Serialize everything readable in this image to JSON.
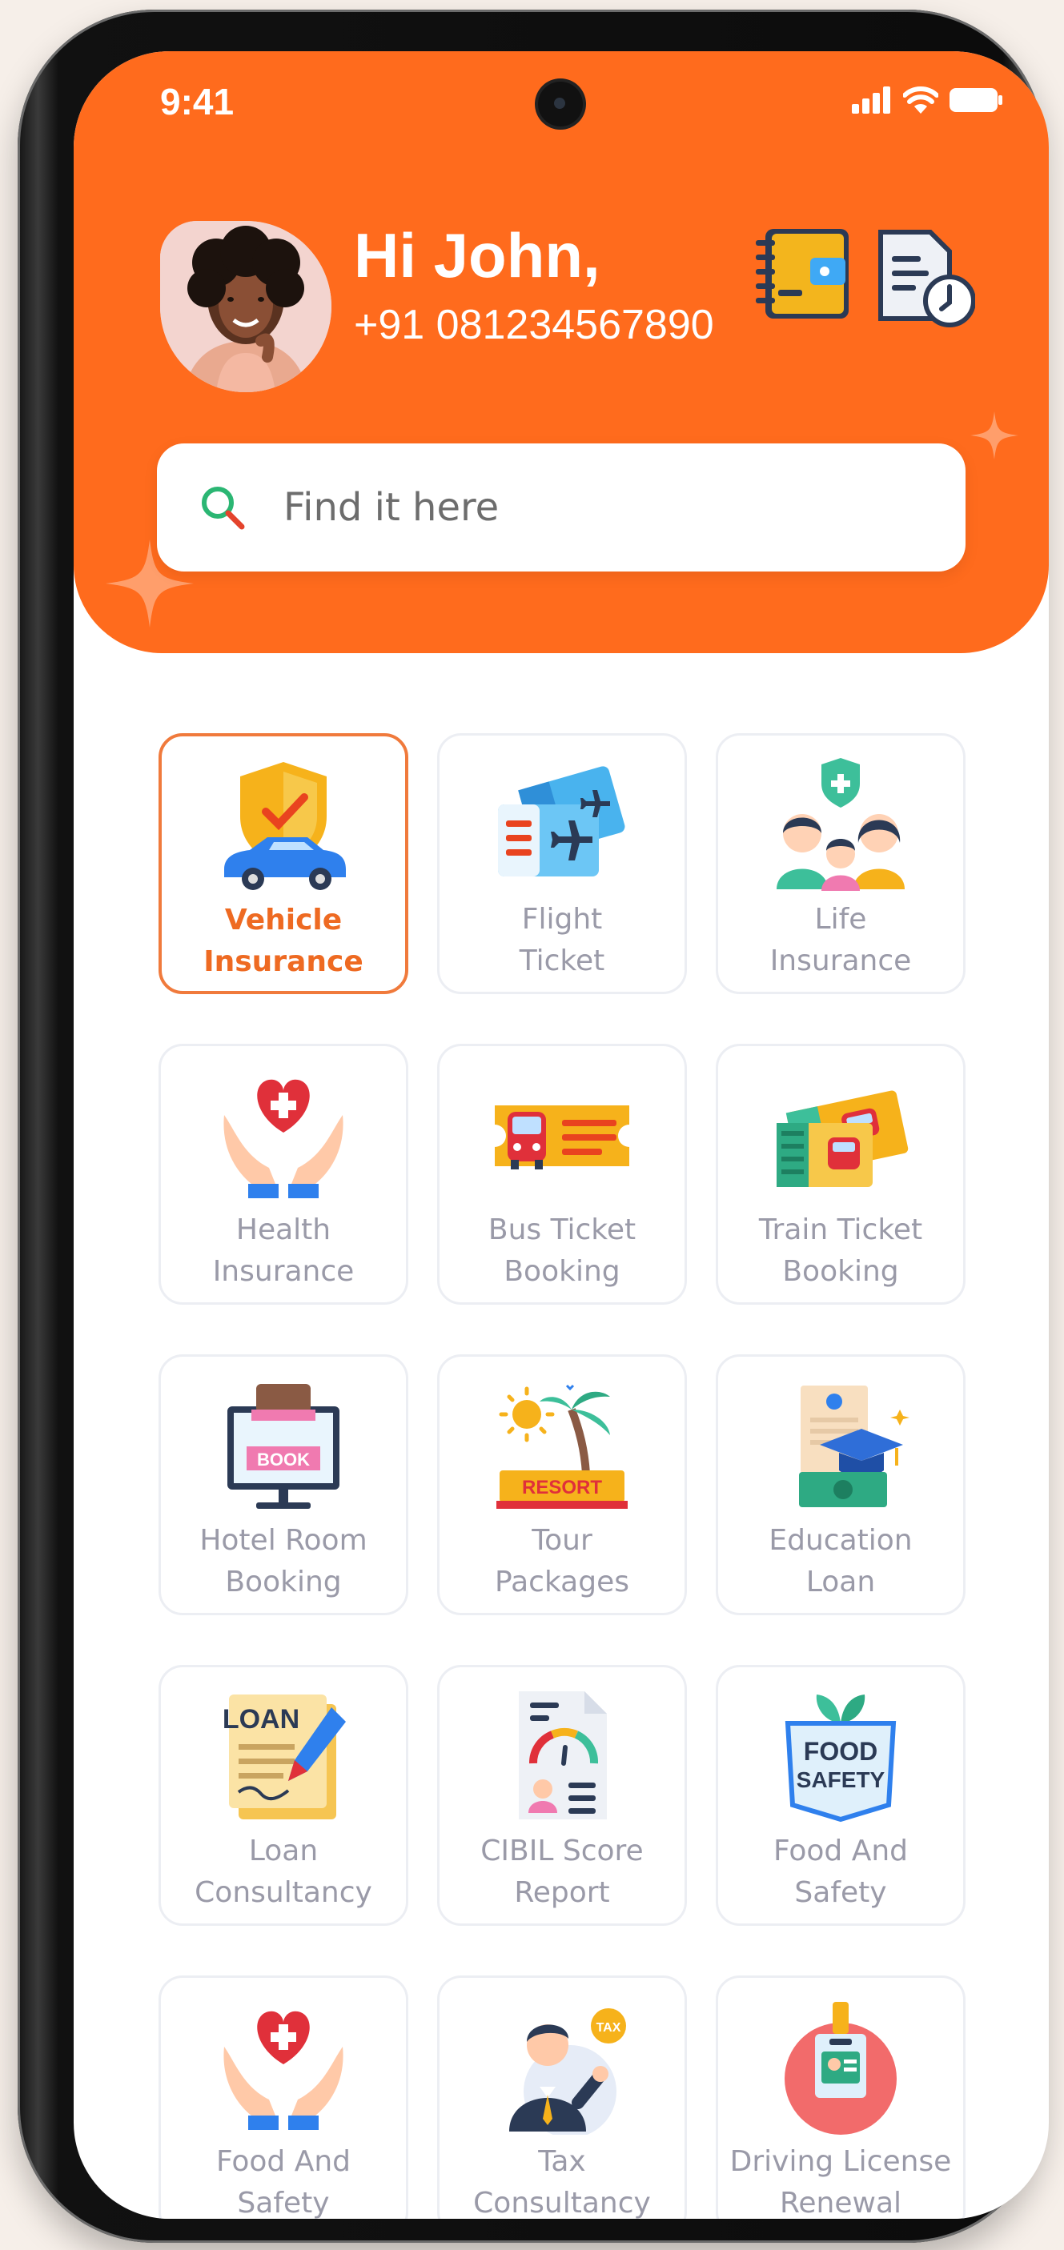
{
  "status_bar": {
    "time": "9:41"
  },
  "header": {
    "greeting": "Hi John,",
    "phone": "+91 081234567890"
  },
  "search": {
    "placeholder": "Find it here"
  },
  "services": [
    {
      "label": "Vehicle\nInsurance",
      "icon": "vehicle-insurance-icon",
      "selected": true
    },
    {
      "label": "Flight\nTicket",
      "icon": "flight-ticket-icon"
    },
    {
      "label": "Life\nInsurance",
      "icon": "life-insurance-icon"
    },
    {
      "label": "Health\nInsurance",
      "icon": "health-insurance-icon"
    },
    {
      "label": "Bus Ticket\nBooking",
      "icon": "bus-ticket-icon"
    },
    {
      "label": "Train Ticket\nBooking",
      "icon": "train-ticket-icon"
    },
    {
      "label": "Hotel Room\nBooking",
      "icon": "hotel-booking-icon",
      "art_text": "BOOK"
    },
    {
      "label": "Tour\nPackages",
      "icon": "tour-packages-icon",
      "art_text": "RESORT"
    },
    {
      "label": "Education\nLoan",
      "icon": "education-loan-icon"
    },
    {
      "label": "Loan\nConsultancy",
      "icon": "loan-consultancy-icon",
      "art_text": "LOAN"
    },
    {
      "label": "CIBIL Score\nReport",
      "icon": "cibil-report-icon"
    },
    {
      "label": "Food And\nSafety",
      "icon": "food-safety-icon",
      "art_text": "FOOD\nSAFETY"
    },
    {
      "label": "Food And\nSafety",
      "icon": "care-hands-icon"
    },
    {
      "label": "Tax\nConsultancy",
      "icon": "tax-consultant-icon",
      "art_text": "TAX"
    },
    {
      "label": "Driving License\nRenewal",
      "icon": "driving-license-icon"
    }
  ],
  "colors": {
    "brand": "#ff6b1d",
    "active_border": "#f07a3c",
    "active_text": "#ee6a22",
    "label": "#9a9aa8"
  }
}
